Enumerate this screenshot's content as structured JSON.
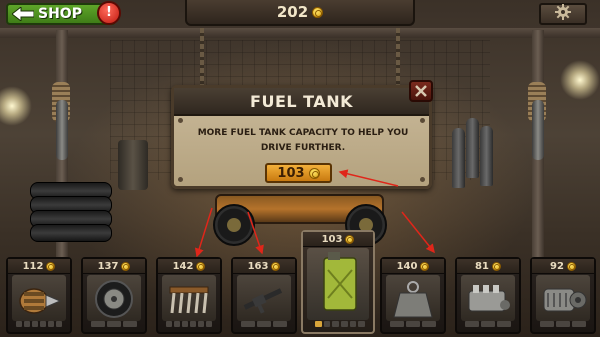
{
  "topbar": {
    "shop_label": "SHOP",
    "alert_badge": "!",
    "coins": "202",
    "settings_icon": "gear-icon"
  },
  "dialog": {
    "title": "FUEL TANK",
    "description_line1": "MORE FUEL TANK CAPACITY TO HELP YOU",
    "description_line2": "DRIVE FURTHER.",
    "price": "103",
    "close_icon": "close-icon"
  },
  "upgrades": [
    {
      "name": "engine",
      "price": "112",
      "icon": "engine-icon",
      "level": 0,
      "max_level": 6
    },
    {
      "name": "wheels",
      "price": "137",
      "icon": "wheel-icon",
      "level": 0,
      "max_level": 3
    },
    {
      "name": "ram-plow",
      "price": "142",
      "icon": "ram-icon",
      "level": 0,
      "max_level": 6
    },
    {
      "name": "gun",
      "price": "163",
      "icon": "gun-icon",
      "level": 0,
      "max_level": 3
    },
    {
      "name": "fuel-tank",
      "price": "103",
      "icon": "fuel-can-icon",
      "level": 1,
      "max_level": 6,
      "selected": true
    },
    {
      "name": "weight",
      "price": "140",
      "icon": "weight-icon",
      "level": 0,
      "max_level": 3
    },
    {
      "name": "turbo",
      "price": "81",
      "icon": "turbo-icon",
      "level": 0,
      "max_level": 3
    },
    {
      "name": "gearbox",
      "price": "92",
      "icon": "gearbox-icon",
      "level": 0,
      "max_level": 3
    }
  ],
  "colors": {
    "shop_button": "#4f9522",
    "coin": "#f5c72c",
    "buy_button": "#e39a22",
    "arrow": "#e0261a"
  }
}
